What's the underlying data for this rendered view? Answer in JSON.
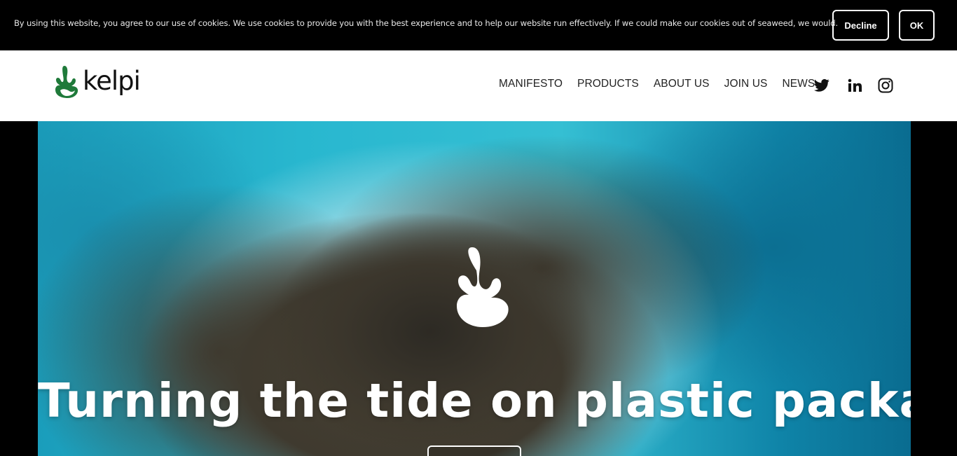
{
  "cookie_bar": {
    "message": "By using this website, you agree to our use of cookies. We use cookies to provide you with the best experience and to help our website run effectively. If we could make our cookies out of seaweed, we would.",
    "decline_label": "Decline",
    "ok_label": "OK"
  },
  "header": {
    "logo_text": "kelpi",
    "brand_color": "#1f7a3a",
    "nav": [
      "MANIFESTO",
      "PRODUCTS",
      "ABOUT US",
      "JOIN US",
      "NEWS"
    ],
    "social_icons": [
      "twitter-icon",
      "linkedin-icon",
      "instagram-icon"
    ]
  },
  "hero": {
    "title": "Turning the tide on plastic packaging",
    "cta_label": ""
  }
}
